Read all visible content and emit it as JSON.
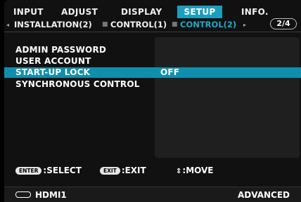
{
  "tabs": [
    {
      "label": "INPUT"
    },
    {
      "label": "ADJUST"
    },
    {
      "label": "DISPLAY"
    },
    {
      "label": "SETUP"
    },
    {
      "label": "INFO."
    }
  ],
  "subtabs": {
    "left_arrow": "◂",
    "items": [
      {
        "label": "INSTALLATION(2)"
      },
      {
        "label": "CONTROL(1)"
      },
      {
        "label": "CONTROL(2)"
      }
    ],
    "separator": "■",
    "right_arrow": "▸",
    "page": "2/4"
  },
  "menu_items": [
    {
      "label": "ADMIN PASSWORD",
      "value": ""
    },
    {
      "label": "USER ACCOUNT",
      "value": ""
    },
    {
      "label": "START-UP LOCK",
      "value": "OFF"
    },
    {
      "label": "SYNCHRONOUS CONTROL",
      "value": ""
    }
  ],
  "hints": {
    "enter_key": "ENTER",
    "enter_label": ":SELECT",
    "exit_key": "EXIT",
    "exit_label": ":EXIT",
    "move_icon": "⇕",
    "move_label": ":MOVE"
  },
  "status": {
    "source": "HDMI1",
    "mode": "ADVANCED"
  },
  "colors": {
    "active_tab": "#1b9fbf",
    "selected_row": "#0f8fad",
    "active_subtab_text": "#1ba9cd"
  }
}
